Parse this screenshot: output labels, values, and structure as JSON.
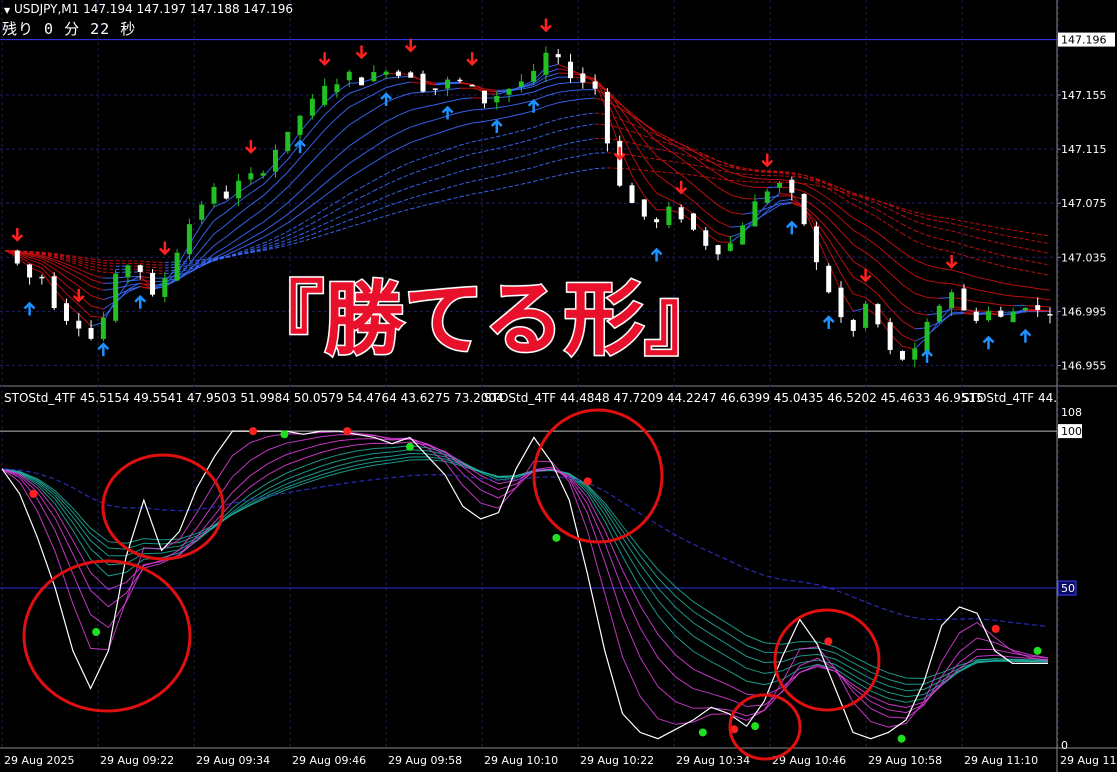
{
  "header": {
    "symbol_line": "USDJPY,M1  147.194 147.197 147.188 147.196",
    "timer_text": "残り 0 分 22 秒"
  },
  "sub_header": {
    "indicator_text_1": "STOStd_4TF 45.5154 49.5541 47.9503 51.9984 50.0579 54.4764 43.6275 73.2004",
    "indicator_text_2": "STOStd_4TF 44.4848 47.7209 44.2247 46.6399 45.0435 46.5202 45.4633 46.9515",
    "indicator_text_3": "STOStd_4TF 44."
  },
  "banner_text": "『勝てる形』",
  "colors": {
    "bull": "#22c022",
    "bear": "#ffffff",
    "up_arrow": "#1e90ff",
    "down_arrow": "#ff2020",
    "fan_blue": "#3a6cff",
    "fan_red": "#d01010",
    "osc_main": "#ffffff",
    "osc_fan_a": "#e040e0",
    "osc_fan_b": "#20b0a0",
    "circle": "#e01010",
    "dot_red": "#ff2020",
    "dot_green": "#20e020"
  },
  "chart_data": [
    {
      "type": "candlestick",
      "title": "USDJPY,M1",
      "y_ticks": [
        "147.196",
        "147.155",
        "147.115",
        "147.075",
        "147.035",
        "146.995",
        "146.955"
      ],
      "current_price": "147.196",
      "ylim": [
        146.942,
        147.209
      ],
      "x_labels": [
        "29 Aug 2025",
        "29 Aug 09:22",
        "29 Aug 09:34",
        "29 Aug 09:46",
        "29 Aug 09:58",
        "29 Aug 10:10",
        "29 Aug 10:22",
        "29 Aug 10:34",
        "29 Aug 10:46",
        "29 Aug 10:58",
        "29 Aug 11:10",
        "29 Aug 11:"
      ],
      "close_path": [
        147.04,
        147.03,
        147.02,
        147.02,
        147.0,
        146.99,
        146.985,
        146.975,
        146.99,
        147.02,
        147.03,
        147.025,
        147.005,
        147.02,
        147.04,
        147.06,
        147.075,
        147.085,
        147.08,
        147.09,
        147.095,
        147.1,
        147.115,
        147.125,
        147.14,
        147.15,
        147.16,
        147.165,
        147.17,
        147.165,
        147.17,
        147.175,
        147.17,
        147.17,
        147.16,
        147.16,
        147.165,
        147.165,
        147.16,
        147.15,
        147.155,
        147.16,
        147.165,
        147.17,
        147.185,
        147.18,
        147.17,
        147.165,
        147.16,
        147.12,
        147.09,
        147.075,
        147.065,
        147.06,
        147.07,
        147.065,
        147.055,
        147.045,
        147.04,
        147.045,
        147.06,
        147.075,
        147.085,
        147.09,
        147.08,
        147.06,
        147.03,
        147.01,
        146.99,
        146.98,
        147.0,
        146.985,
        146.965,
        146.96,
        146.965,
        146.985,
        147.0,
        147.01,
        146.995,
        146.99,
        146.995,
        146.99,
        146.995,
        147.0,
        146.995,
        146.995
      ],
      "up_arrows": 14,
      "down_arrows": 14
    },
    {
      "type": "line",
      "title": "STOStd_4TF",
      "y_ticks": [
        "108",
        "100",
        "50",
        "0"
      ],
      "ylim": [
        0,
        108
      ],
      "level_lines": [
        50,
        100
      ],
      "main_series": [
        88,
        80,
        66,
        50,
        30,
        18,
        30,
        60,
        78,
        62,
        68,
        82,
        92,
        100,
        100,
        100,
        100,
        99,
        100,
        100,
        99,
        98,
        96,
        98,
        92,
        86,
        76,
        72,
        74,
        88,
        98,
        90,
        78,
        55,
        30,
        10,
        4,
        2,
        5,
        8,
        12,
        10,
        6,
        14,
        28,
        40,
        32,
        18,
        4,
        2,
        4,
        8,
        20,
        38,
        44,
        42,
        30,
        26,
        26,
        26
      ],
      "red_dots": [
        [
          0.03,
          80
        ],
        [
          0.24,
          100
        ],
        [
          0.33,
          100
        ],
        [
          0.56,
          84
        ],
        [
          0.7,
          5
        ],
        [
          0.79,
          33
        ],
        [
          0.95,
          37
        ]
      ],
      "green_dots": [
        [
          0.09,
          36
        ],
        [
          0.27,
          99
        ],
        [
          0.39,
          95
        ],
        [
          0.53,
          66
        ],
        [
          0.67,
          4
        ],
        [
          0.72,
          6
        ],
        [
          0.86,
          2
        ],
        [
          0.99,
          30
        ]
      ]
    }
  ]
}
